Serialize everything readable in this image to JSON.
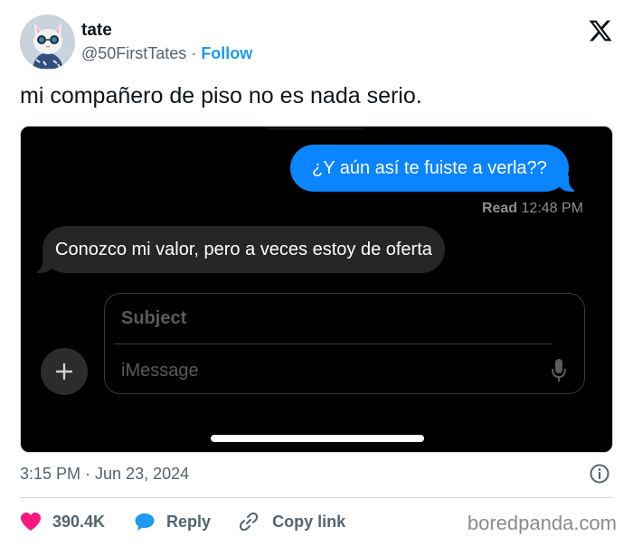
{
  "author": {
    "name": "tate",
    "handle": "@50FirstTates",
    "separator": "·",
    "follow_label": "Follow",
    "avatar_icon": "cat-with-sunglasses-avatar"
  },
  "platform_icon": "x-logo-icon",
  "tweet": {
    "text": "mi compañero de piso no es nada serio."
  },
  "screenshot": {
    "sent_message": "¿Y aún así te fuiste a verla??",
    "read_label": "Read",
    "read_time": "12:48 PM",
    "received_message": "Conozco mi valor, pero a veces estoy de oferta",
    "subject_placeholder": "Subject",
    "message_placeholder": "iMessage"
  },
  "meta": {
    "timestamp": "3:15 PM · Jun 23, 2024"
  },
  "actions": {
    "like_count": "390.4K",
    "reply_label": "Reply",
    "copy_label": "Copy link"
  },
  "watermark": "boredpanda.com",
  "colors": {
    "accent": "#1d9bf0",
    "like": "#f91880",
    "imessage_blue": "#0a84ff"
  }
}
